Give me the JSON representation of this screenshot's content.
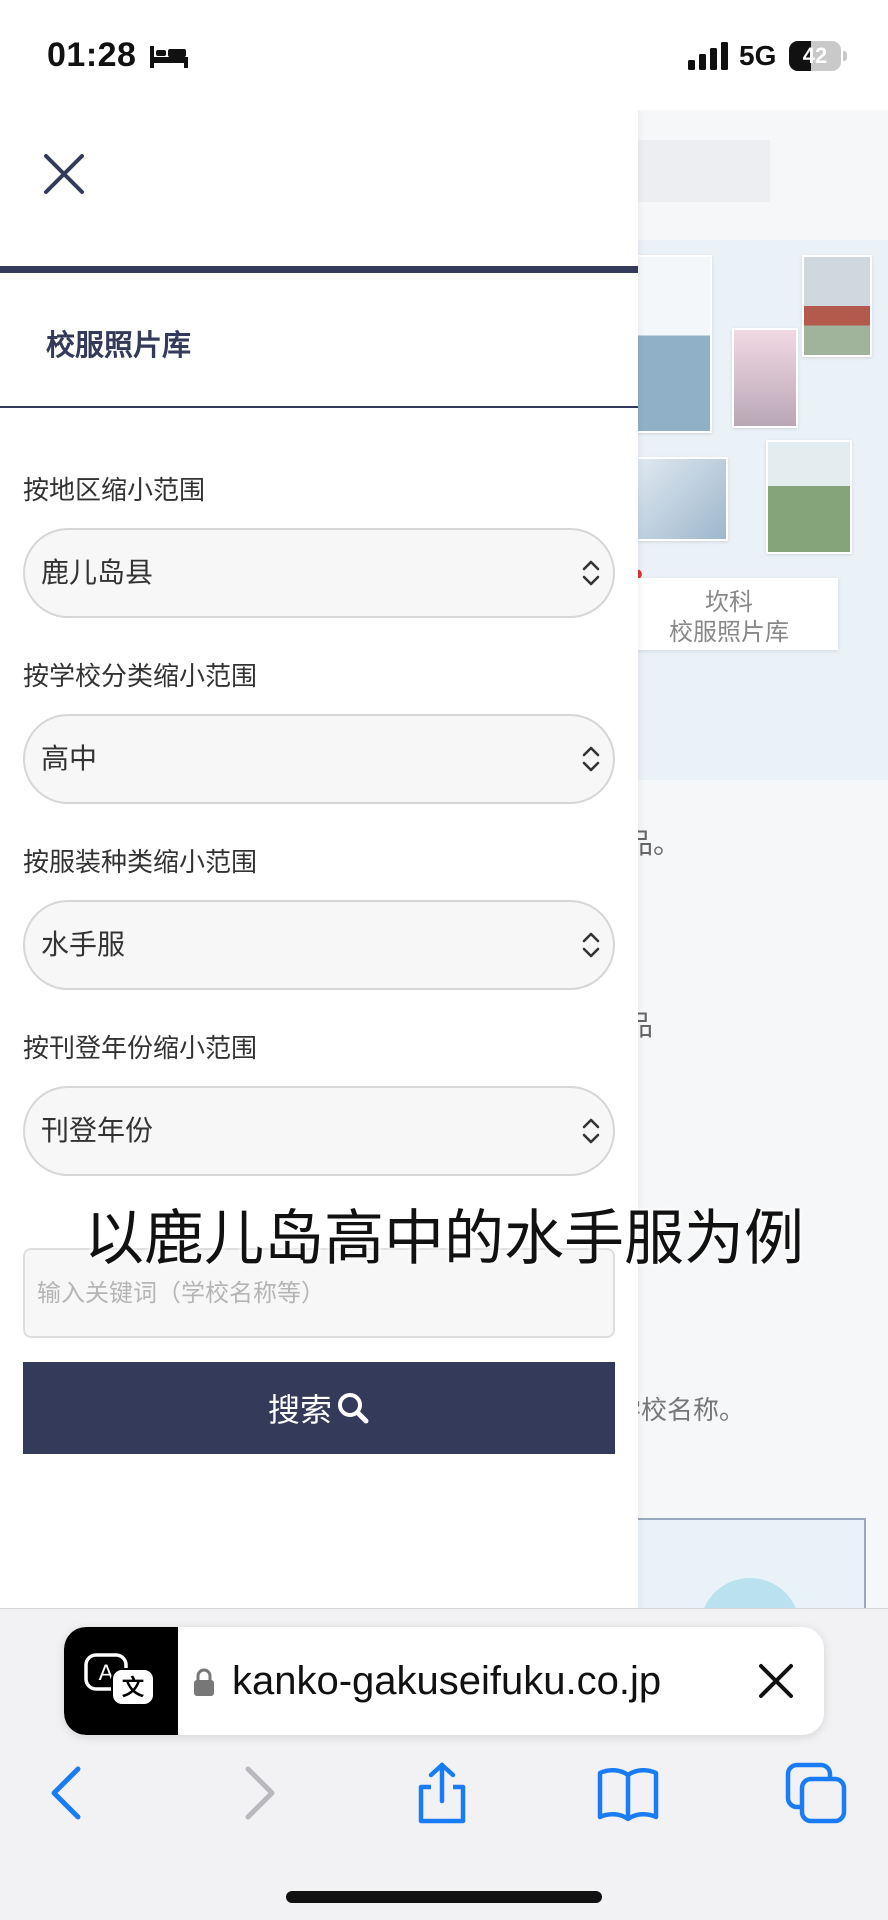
{
  "status_bar": {
    "time": "01:28",
    "network": "5G",
    "battery_level": "42",
    "battery_fraction": 0.42,
    "sleep_icon": "bed-icon",
    "signal_icon": "signal-bars-icon"
  },
  "background_page": {
    "card_line1": "坎科",
    "card_line2": "校服照片库",
    "fragments": [
      "品。",
      "o",
      "品",
      "学校名称。"
    ]
  },
  "drawer": {
    "close_icon": "close-icon",
    "title": "校服照片库",
    "filters": [
      {
        "label": "按地区缩小范围",
        "value": "鹿儿岛县"
      },
      {
        "label": "按学校分类缩小范围",
        "value": "高中"
      },
      {
        "label": "按服装种类缩小范围",
        "value": "水手服"
      },
      {
        "label": "按刊登年份缩小范围",
        "value": "刊登年份"
      }
    ],
    "keyword_placeholder": "输入关键词（学校名称等）",
    "search_label": "搜索",
    "search_icon": "search-icon"
  },
  "caption": "以鹿儿岛高中的水手服为例",
  "browser": {
    "url": "kanko-gakuseifuku.co.jp",
    "translate_icon": "translate-icon",
    "lock_icon": "lock-icon",
    "clear_icon": "close-icon",
    "nav": [
      "back-icon",
      "forward-icon",
      "share-icon",
      "bookmarks-icon",
      "tabs-icon"
    ]
  },
  "colors": {
    "accent": "#343a59",
    "link_blue": "#1a7cf5"
  }
}
